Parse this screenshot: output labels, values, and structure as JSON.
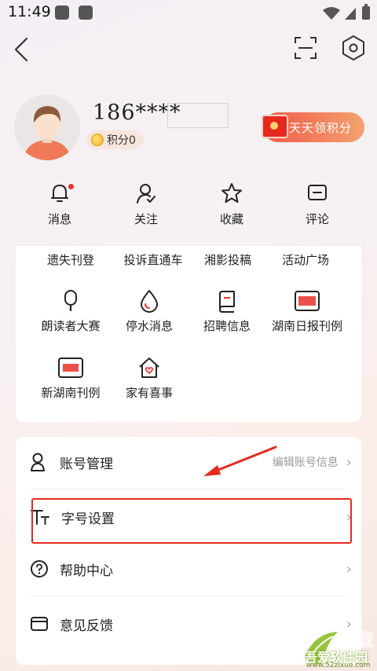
{
  "status_bar": {
    "time": "11:49"
  },
  "profile": {
    "username": "186****",
    "points_label": "积分0",
    "daily_points_button": "天天领积分"
  },
  "quick_actions": [
    {
      "label": "消息",
      "icon": "bell-icon",
      "badge": true
    },
    {
      "label": "关注",
      "icon": "user-check-icon",
      "badge": false
    },
    {
      "label": "收藏",
      "icon": "star-icon",
      "badge": false
    },
    {
      "label": "评论",
      "icon": "comment-icon",
      "badge": false
    }
  ],
  "services": {
    "row1": [
      "遗失刊登",
      "投诉直通车",
      "湘影投稿",
      "活动广场"
    ],
    "row2": [
      {
        "label": "朗读者大赛",
        "icon": "microphone-icon"
      },
      {
        "label": "停水消息",
        "icon": "water-drop-icon"
      },
      {
        "label": "招聘信息",
        "icon": "document-icon"
      },
      {
        "label": "湖南日报刊例",
        "icon": "hunan-daily-logo-icon"
      }
    ],
    "row3": [
      {
        "label": "新湖南刊例",
        "icon": "new-hunan-logo-icon"
      },
      {
        "label": "家有喜事",
        "icon": "home-heart-icon"
      }
    ]
  },
  "settings": [
    {
      "label": "账号管理",
      "hint": "编辑账号信息",
      "icon": "account-icon"
    },
    {
      "label": "字号设置",
      "hint": "",
      "icon": "font-size-icon"
    },
    {
      "label": "帮助中心",
      "hint": "",
      "icon": "help-icon"
    },
    {
      "label": "意见反馈",
      "hint": "",
      "icon": "feedback-icon"
    }
  ],
  "watermark": {
    "text": "吾爱软件园",
    "url": "www.52zixue.com"
  },
  "colors": {
    "accent_red": "#e52a1f",
    "points_gradient_start": "#f05a4a",
    "points_gradient_end": "#f3a26f"
  }
}
